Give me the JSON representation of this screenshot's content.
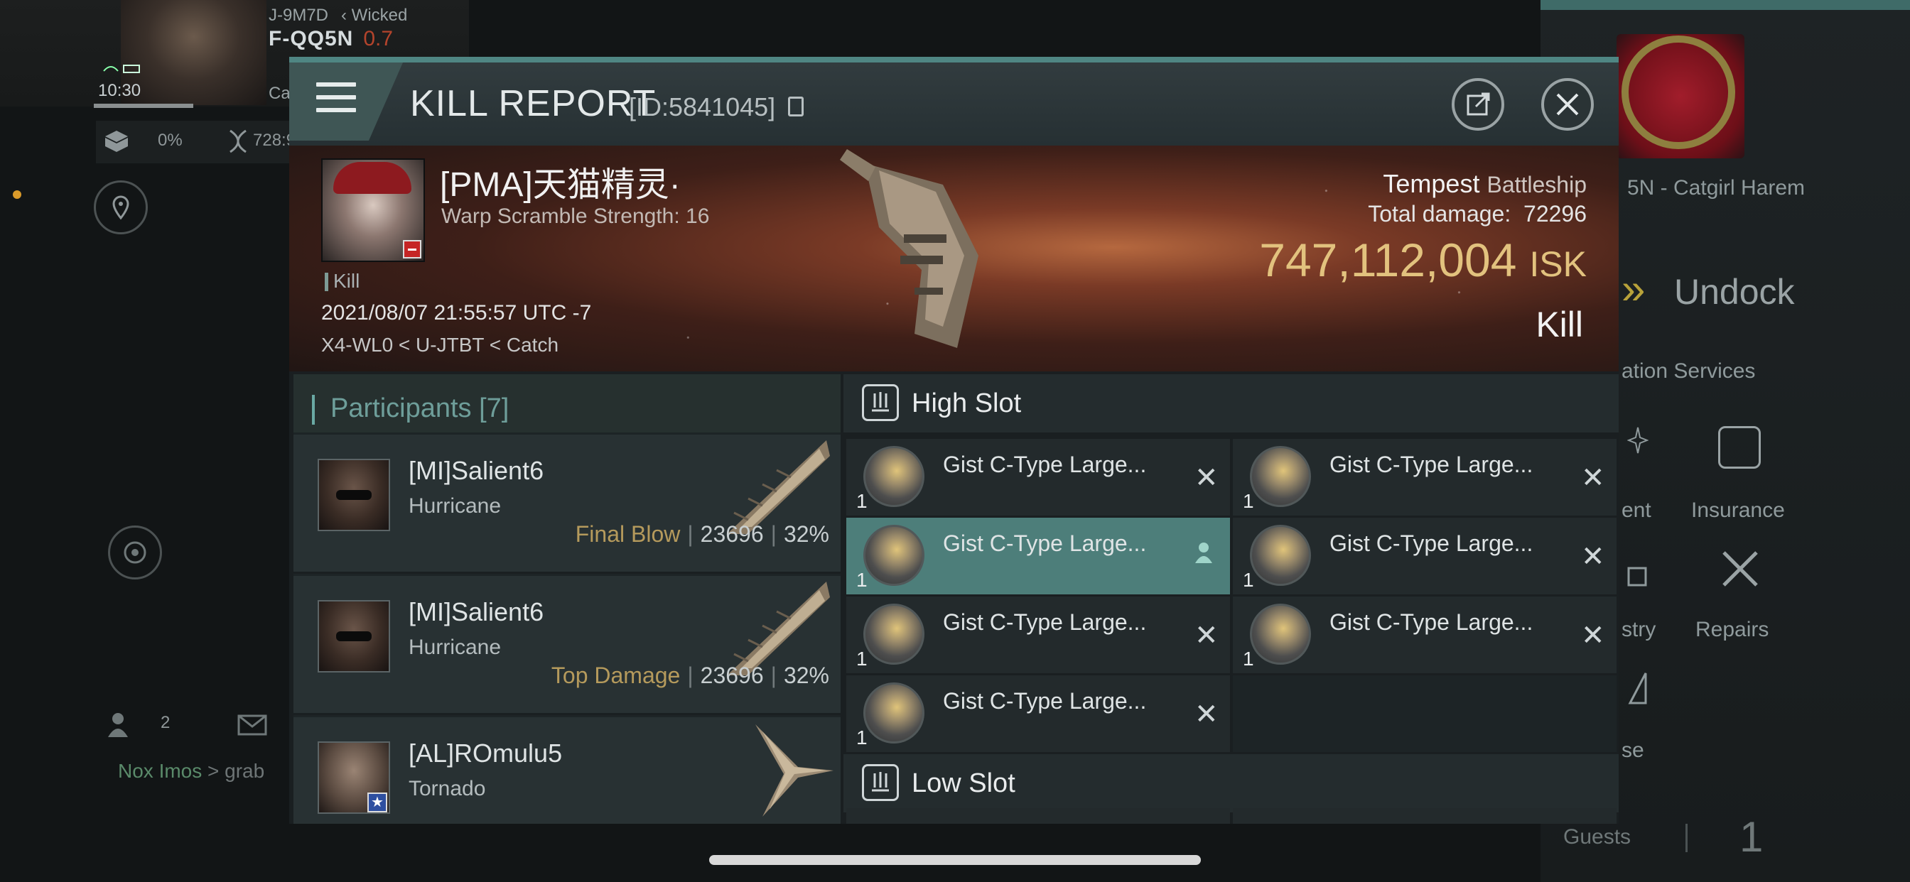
{
  "background": {
    "header": {
      "system_code": "J-9M7D",
      "alliance_tag": "Wicked",
      "system_name": "F-QQ5N",
      "security": "0.7",
      "time": "10:30",
      "corp_short": "Ca",
      "cargo_pct": "0%",
      "stat_value": "728:9"
    },
    "station": {
      "name": "5N - Catgirl Harem",
      "undock_label": "Undock",
      "services_label": "ation Services",
      "services": [
        "ent",
        "Insurance",
        "stry",
        "Repairs",
        "se"
      ]
    },
    "guests": {
      "label": "Guests",
      "count": "1"
    },
    "social": {
      "count": "2"
    },
    "chat": {
      "speaker": "Nox Imos",
      "message": "> grab"
    }
  },
  "kill_report": {
    "title": "KILL REPORT",
    "id": "[ID:5841045]",
    "victim": {
      "name": "[PMA]天猫精灵·",
      "subtitle": "Warp Scramble Strength: 16",
      "tag": "Kill",
      "date": "2021/08/07 21:55:57 UTC -7",
      "location": "X4-WL0 < U-JTBT < Catch"
    },
    "ship": {
      "name": "Tempest",
      "class": "Battleship"
    },
    "total_damage_label": "Total damage:",
    "total_damage": "72296",
    "isk_value": "747,112,004",
    "isk_unit": "ISK",
    "result": "Kill",
    "participants_title": "Participants [7]",
    "participants": [
      {
        "name": "[MI]Salient6",
        "ship": "Hurricane",
        "tag": "Final Blow",
        "damage": "23696",
        "pct": "32%"
      },
      {
        "name": "[MI]Salient6",
        "ship": "Hurricane",
        "tag": "Top Damage",
        "damage": "23696",
        "pct": "32%"
      },
      {
        "name": "[AL]ROmulu5",
        "ship": "Tornado",
        "tag": "",
        "damage": "",
        "pct": ""
      }
    ],
    "high_slot_title": "High Slot",
    "low_slot_title": "Low Slot",
    "modules": [
      {
        "name": "Gist C-Type Large...",
        "qty": "1",
        "status": "destroyed"
      },
      {
        "name": "Gist C-Type Large...",
        "qty": "1",
        "status": "destroyed"
      },
      {
        "name": "Gist C-Type Large...",
        "qty": "1",
        "status": "dropped"
      },
      {
        "name": "Gist C-Type Large...",
        "qty": "1",
        "status": "destroyed"
      },
      {
        "name": "Gist C-Type Large...",
        "qty": "1",
        "status": "destroyed"
      },
      {
        "name": "Gist C-Type Large...",
        "qty": "1",
        "status": "destroyed"
      },
      {
        "name": "Gist C-Type Large...",
        "qty": "1",
        "status": "destroyed"
      }
    ],
    "colors": {
      "accent": "#4f8683",
      "isk": "#e2c27e",
      "selected_row": "#4d7e7a"
    }
  }
}
